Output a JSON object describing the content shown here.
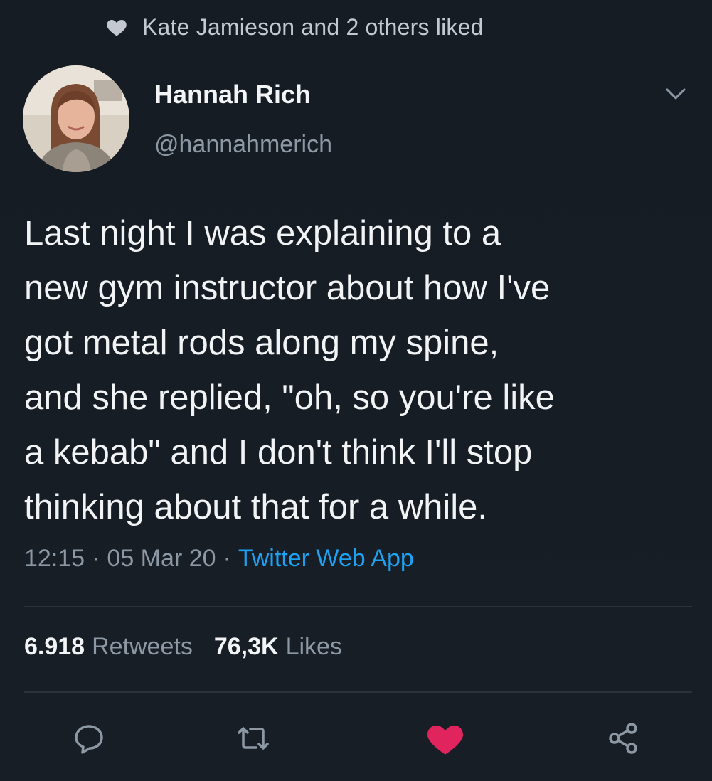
{
  "social_context": {
    "text": "Kate Jamieson and 2 others liked",
    "icon": "heart-icon"
  },
  "author": {
    "name": "Hannah Rich",
    "handle": "@hannahmerich",
    "avatar_icon": "avatar"
  },
  "tweet": {
    "text": "Last night I was explaining to a\nnew gym instructor about how I've\ngot metal rods along my spine,\nand she replied, \"oh, so you're like\na kebab\" and I don't think I'll stop\nthinking about that for a while."
  },
  "meta": {
    "time": "12:15",
    "sep1": "·",
    "date": "05 Mar 20",
    "sep2": "·",
    "app": "Twitter Web App"
  },
  "stats": {
    "retweets_count": "6.918",
    "retweets_label": "Retweets",
    "likes_count": "76,3K",
    "likes_label": "Likes"
  },
  "actions": [
    {
      "name": "reply",
      "icon": "reply-icon"
    },
    {
      "name": "retweet",
      "icon": "retweet-icon"
    },
    {
      "name": "like",
      "icon": "heart-icon",
      "active": true
    },
    {
      "name": "share",
      "icon": "share-icon"
    }
  ],
  "colors": {
    "background": "#171d24",
    "link": "#1da1f2",
    "like_active": "#e0245e",
    "muted_text": "#8c98a4"
  }
}
